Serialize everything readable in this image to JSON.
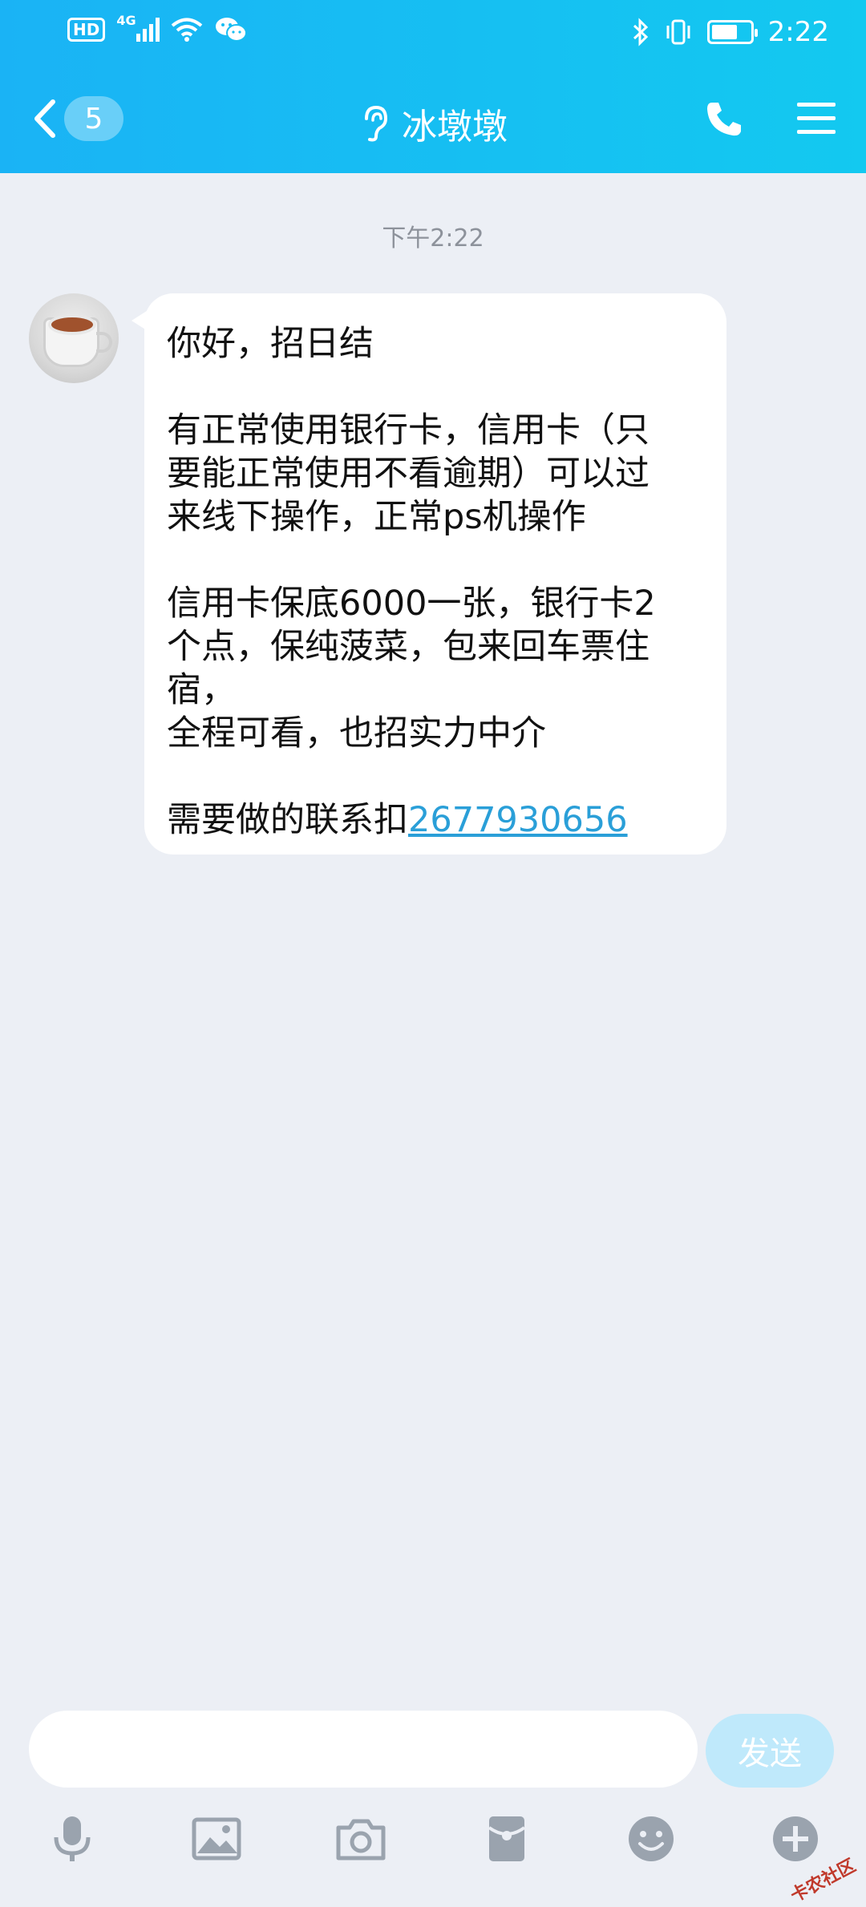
{
  "status_bar": {
    "hd": "HD",
    "network": "4G",
    "time": "2:22"
  },
  "header": {
    "back_count": "5",
    "title": "冰墩墩"
  },
  "chat": {
    "timestamp": "下午2:22",
    "message": {
      "line1": "你好，招日结",
      "line2": "有正常使用银行卡，信用卡（只",
      "line3": "要能正常使用不看逾期）可以过",
      "line4": "来线下操作，正常ps机操作",
      "line5": "信用卡保底6000一张，银行卡2",
      "line6": "个点，保纯菠菜，包来回车票住",
      "line7": "宿，",
      "line8": "全程可看，也招实力中介",
      "line9_prefix": "需要做的联系扣",
      "qq_number": "2677930656"
    }
  },
  "input": {
    "placeholder": "",
    "send_label": "发送"
  },
  "toolbar_icons": [
    "microphone-icon",
    "image-icon",
    "camera-icon",
    "red-packet-icon",
    "emoji-icon",
    "plus-icon"
  ],
  "watermark": "卡农社区",
  "colors": {
    "header_start": "#1ab3f5",
    "header_end": "#13c9f0",
    "link": "#2a9fd8",
    "send_disabled": "#bfe9fb",
    "background": "#eceff5",
    "icon_gray": "#9aa3ae"
  }
}
